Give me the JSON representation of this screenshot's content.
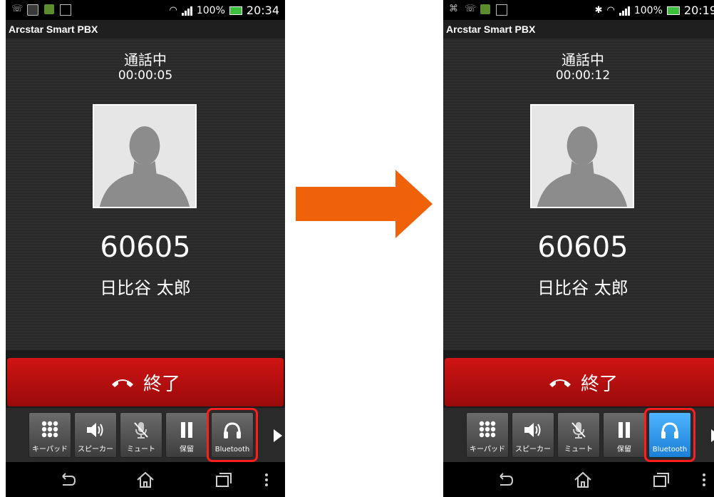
{
  "arrow_color": "#f0620a",
  "end_color": "#d01414",
  "screens": [
    {
      "status_icons_left": [
        "missed-call-icon",
        "sim-card-icon",
        "app-notification-icon",
        "checkbox-icon"
      ],
      "battery": "100%",
      "time": "20:34",
      "app_title": "Arcstar Smart PBX",
      "call_status": "通話中",
      "timer": "00:00:05",
      "number": "60605",
      "name": "日比谷 太郎",
      "end_label": "終了",
      "toolbar": [
        "キーパッド",
        "スピーカー",
        "ミュート",
        "保留",
        "Bluetooth"
      ],
      "bluetooth_active": false
    },
    {
      "status_icons_left": [
        "usb-debug-icon",
        "missed-call-icon",
        "app-notification-icon",
        "checkbox-icon"
      ],
      "battery": "100%",
      "time": "20:19",
      "app_title": "Arcstar Smart PBX",
      "call_status": "通話中",
      "timer": "00:00:12",
      "number": "60605",
      "name": "日比谷 太郎",
      "end_label": "終了",
      "toolbar": [
        "キーパッド",
        "スピーカー",
        "ミュート",
        "保留",
        "Bluetooth"
      ],
      "bluetooth_active": true
    }
  ]
}
